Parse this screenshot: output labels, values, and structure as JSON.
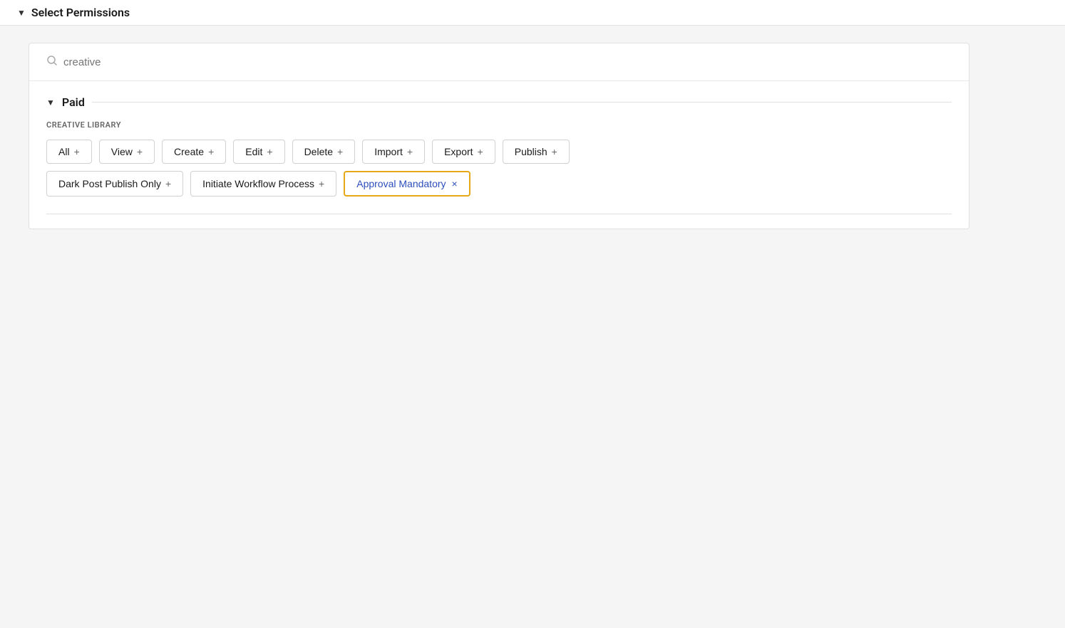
{
  "header": {
    "chevron": "▼",
    "title": "Select Permissions"
  },
  "search": {
    "placeholder": "creative"
  },
  "paid": {
    "chevron": "▼",
    "title": "Paid",
    "section_label": "CREATIVE LIBRARY",
    "buttons_row1": [
      {
        "label": "All",
        "icon": "+"
      },
      {
        "label": "View",
        "icon": "+"
      },
      {
        "label": "Create",
        "icon": "+"
      },
      {
        "label": "Edit",
        "icon": "+"
      },
      {
        "label": "Delete",
        "icon": "+"
      },
      {
        "label": "Import",
        "icon": "+"
      },
      {
        "label": "Export",
        "icon": "+"
      },
      {
        "label": "Publish",
        "icon": "+"
      }
    ],
    "buttons_row2": [
      {
        "label": "Dark Post Publish Only",
        "icon": "+"
      },
      {
        "label": "Initiate Workflow Process",
        "icon": "+"
      }
    ],
    "active_button": {
      "label": "Approval Mandatory",
      "close_icon": "×"
    }
  }
}
